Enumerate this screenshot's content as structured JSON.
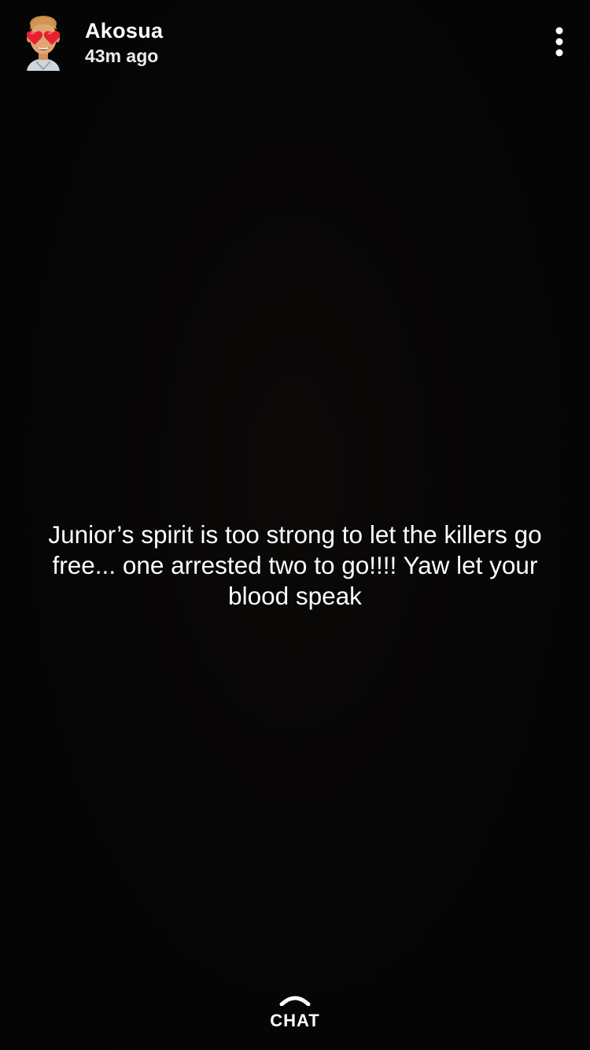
{
  "story": {
    "user": {
      "name": "Akosua",
      "time_ago": "43m ago",
      "avatar_icon": "bitmoji-heart-eyes-avatar-icon"
    },
    "menu_icon": "more-vertical-icon",
    "caption": "Junior’s spirit is too strong to let the killers go free... one arrested two to go!!!! Yaw let your blood speak",
    "chat": {
      "label": "CHAT",
      "icon": "chevron-up-icon"
    }
  },
  "colors": {
    "background": "#050505",
    "text": "#ffffff",
    "heart": "#e8202f",
    "skin": "#e0a572"
  }
}
